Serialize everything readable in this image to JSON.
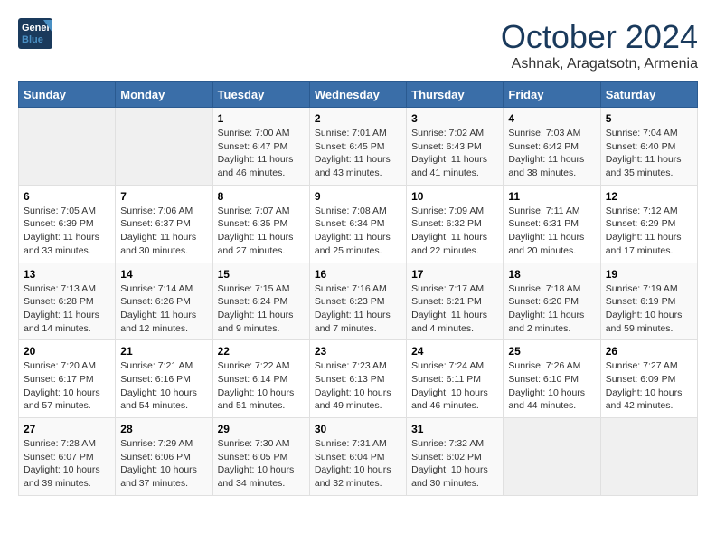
{
  "logo": {
    "line1": "General",
    "line2": "Blue"
  },
  "title": "October 2024",
  "subtitle": "Ashnak, Aragatsotn, Armenia",
  "days_of_week": [
    "Sunday",
    "Monday",
    "Tuesday",
    "Wednesday",
    "Thursday",
    "Friday",
    "Saturday"
  ],
  "weeks": [
    [
      {
        "day": "",
        "empty": true
      },
      {
        "day": "",
        "empty": true
      },
      {
        "day": "1",
        "sunrise": "7:00 AM",
        "sunset": "6:47 PM",
        "daylight": "11 hours and 46 minutes."
      },
      {
        "day": "2",
        "sunrise": "7:01 AM",
        "sunset": "6:45 PM",
        "daylight": "11 hours and 43 minutes."
      },
      {
        "day": "3",
        "sunrise": "7:02 AM",
        "sunset": "6:43 PM",
        "daylight": "11 hours and 41 minutes."
      },
      {
        "day": "4",
        "sunrise": "7:03 AM",
        "sunset": "6:42 PM",
        "daylight": "11 hours and 38 minutes."
      },
      {
        "day": "5",
        "sunrise": "7:04 AM",
        "sunset": "6:40 PM",
        "daylight": "11 hours and 35 minutes."
      }
    ],
    [
      {
        "day": "6",
        "sunrise": "7:05 AM",
        "sunset": "6:39 PM",
        "daylight": "11 hours and 33 minutes."
      },
      {
        "day": "7",
        "sunrise": "7:06 AM",
        "sunset": "6:37 PM",
        "daylight": "11 hours and 30 minutes."
      },
      {
        "day": "8",
        "sunrise": "7:07 AM",
        "sunset": "6:35 PM",
        "daylight": "11 hours and 27 minutes."
      },
      {
        "day": "9",
        "sunrise": "7:08 AM",
        "sunset": "6:34 PM",
        "daylight": "11 hours and 25 minutes."
      },
      {
        "day": "10",
        "sunrise": "7:09 AM",
        "sunset": "6:32 PM",
        "daylight": "11 hours and 22 minutes."
      },
      {
        "day": "11",
        "sunrise": "7:11 AM",
        "sunset": "6:31 PM",
        "daylight": "11 hours and 20 minutes."
      },
      {
        "day": "12",
        "sunrise": "7:12 AM",
        "sunset": "6:29 PM",
        "daylight": "11 hours and 17 minutes."
      }
    ],
    [
      {
        "day": "13",
        "sunrise": "7:13 AM",
        "sunset": "6:28 PM",
        "daylight": "11 hours and 14 minutes."
      },
      {
        "day": "14",
        "sunrise": "7:14 AM",
        "sunset": "6:26 PM",
        "daylight": "11 hours and 12 minutes."
      },
      {
        "day": "15",
        "sunrise": "7:15 AM",
        "sunset": "6:24 PM",
        "daylight": "11 hours and 9 minutes."
      },
      {
        "day": "16",
        "sunrise": "7:16 AM",
        "sunset": "6:23 PM",
        "daylight": "11 hours and 7 minutes."
      },
      {
        "day": "17",
        "sunrise": "7:17 AM",
        "sunset": "6:21 PM",
        "daylight": "11 hours and 4 minutes."
      },
      {
        "day": "18",
        "sunrise": "7:18 AM",
        "sunset": "6:20 PM",
        "daylight": "11 hours and 2 minutes."
      },
      {
        "day": "19",
        "sunrise": "7:19 AM",
        "sunset": "6:19 PM",
        "daylight": "10 hours and 59 minutes."
      }
    ],
    [
      {
        "day": "20",
        "sunrise": "7:20 AM",
        "sunset": "6:17 PM",
        "daylight": "10 hours and 57 minutes."
      },
      {
        "day": "21",
        "sunrise": "7:21 AM",
        "sunset": "6:16 PM",
        "daylight": "10 hours and 54 minutes."
      },
      {
        "day": "22",
        "sunrise": "7:22 AM",
        "sunset": "6:14 PM",
        "daylight": "10 hours and 51 minutes."
      },
      {
        "day": "23",
        "sunrise": "7:23 AM",
        "sunset": "6:13 PM",
        "daylight": "10 hours and 49 minutes."
      },
      {
        "day": "24",
        "sunrise": "7:24 AM",
        "sunset": "6:11 PM",
        "daylight": "10 hours and 46 minutes."
      },
      {
        "day": "25",
        "sunrise": "7:26 AM",
        "sunset": "6:10 PM",
        "daylight": "10 hours and 44 minutes."
      },
      {
        "day": "26",
        "sunrise": "7:27 AM",
        "sunset": "6:09 PM",
        "daylight": "10 hours and 42 minutes."
      }
    ],
    [
      {
        "day": "27",
        "sunrise": "7:28 AM",
        "sunset": "6:07 PM",
        "daylight": "10 hours and 39 minutes."
      },
      {
        "day": "28",
        "sunrise": "7:29 AM",
        "sunset": "6:06 PM",
        "daylight": "10 hours and 37 minutes."
      },
      {
        "day": "29",
        "sunrise": "7:30 AM",
        "sunset": "6:05 PM",
        "daylight": "10 hours and 34 minutes."
      },
      {
        "day": "30",
        "sunrise": "7:31 AM",
        "sunset": "6:04 PM",
        "daylight": "10 hours and 32 minutes."
      },
      {
        "day": "31",
        "sunrise": "7:32 AM",
        "sunset": "6:02 PM",
        "daylight": "10 hours and 30 minutes."
      },
      {
        "day": "",
        "empty": true
      },
      {
        "day": "",
        "empty": true
      }
    ]
  ]
}
